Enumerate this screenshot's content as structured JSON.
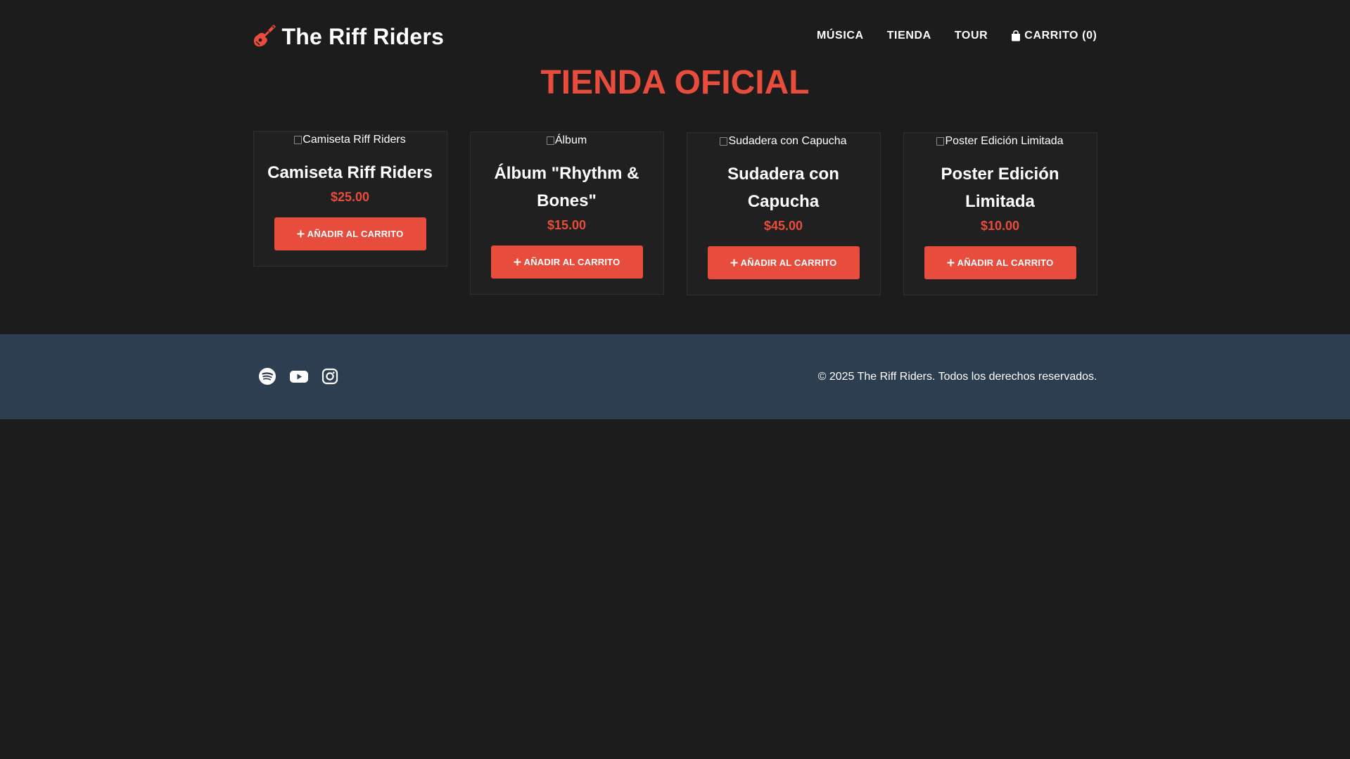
{
  "header": {
    "brand_name": "The Riff Riders",
    "brand_icon": "guitar-icon",
    "nav": [
      {
        "label": "MÚSICA"
      },
      {
        "label": "TIENDA"
      },
      {
        "label": "TOUR"
      }
    ],
    "cart_label": "CARRITO (0)",
    "cart_icon": "shopping-bag-icon"
  },
  "main": {
    "title": "TIENDA OFICIAL",
    "products": [
      {
        "image_alt": "Camiseta Riff Riders",
        "name": "Camiseta Riff Riders",
        "price": "$25.00",
        "button_label": "AÑADIR AL CARRITO"
      },
      {
        "image_alt": "Álbum",
        "name": "Álbum \"Rhythm & Bones\"",
        "price": "$15.00",
        "button_label": "AÑADIR AL CARRITO"
      },
      {
        "image_alt": "Sudadera con Capucha",
        "name": "Sudadera con Capucha",
        "price": "$45.00",
        "button_label": "AÑADIR AL CARRITO"
      },
      {
        "image_alt": "Poster Edición Limitada",
        "name": "Poster Edición Limitada",
        "price": "$10.00",
        "button_label": "AÑADIR AL CARRITO"
      }
    ]
  },
  "footer": {
    "socials": [
      "spotify-icon",
      "youtube-icon",
      "instagram-icon"
    ],
    "copyright": "© 2025 The Riff Riders. Todos los derechos reservados."
  },
  "colors": {
    "accent": "#e74c3c",
    "background": "#1c1c1c",
    "footer": "#2c3e50"
  }
}
